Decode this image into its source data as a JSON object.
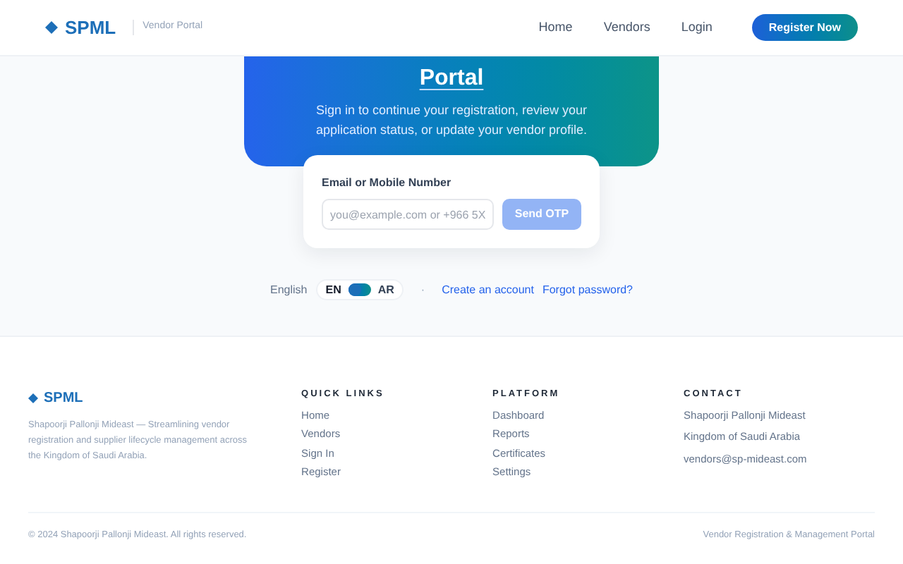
{
  "header": {
    "brand": "SPML",
    "subtitle": "Vendor Portal",
    "nav": [
      "Home",
      "Vendors",
      "Login"
    ],
    "cta": "Register Now"
  },
  "hero": {
    "title": "Portal",
    "text": "Sign in to continue your registration, review your application status, or update your vendor profile."
  },
  "login": {
    "label": "Email or Mobile Number",
    "placeholder": "you@example.com or +966 5X",
    "button": {
      "label": "Send OTP",
      "disabled": true
    }
  },
  "language": {
    "label": "English",
    "options": [
      {
        "label": "EN",
        "selected": true
      },
      {
        "label": "AR",
        "selected": false
      }
    ]
  },
  "separator": "·",
  "links": [
    "Create an account",
    "Forgot password?"
  ],
  "footer": {
    "brand": "SPML",
    "about": "Shapoorji Pallonji Mideast — Streamlining vendor registration and supplier lifecycle management across the Kingdom of Saudi Arabia.",
    "columns": [
      {
        "title": "QUICK LINKS",
        "items": [
          "Home",
          "Vendors",
          "Sign In",
          "Register"
        ]
      },
      {
        "title": "PLATFORM",
        "items": [
          "Dashboard",
          "Reports",
          "Certificates",
          "Settings"
        ]
      },
      {
        "title": "CONTACT",
        "items": [
          "Shapoorji Pallonji Mideast",
          "Kingdom of Saudi Arabia",
          "vendors@sp-mideast.com"
        ]
      }
    ],
    "copyright": "© 2024 Shapoorji Pallonji Mideast. All rights reserved.",
    "tagline": "Vendor Registration & Management Portal"
  }
}
